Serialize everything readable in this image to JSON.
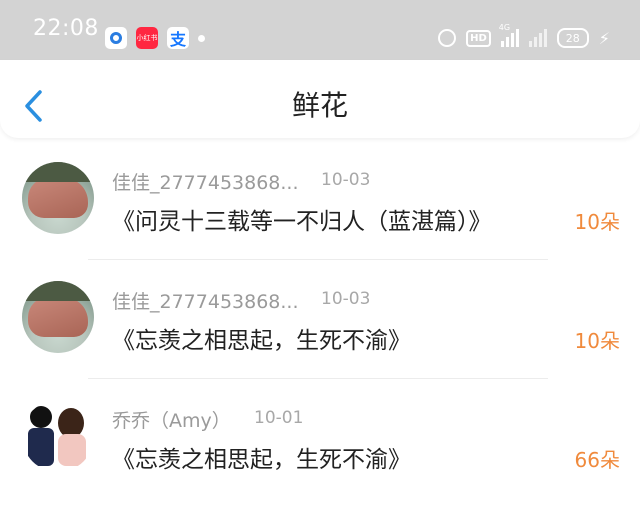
{
  "status_bar": {
    "time": "22:08",
    "apps": [
      "qq-browser-icon",
      "xiaohongshu-icon",
      "alipay-icon"
    ],
    "app_labels": {
      "xiaohongshu": "小红书",
      "alipay": "支"
    },
    "network": "4G",
    "hd": "HD",
    "battery": "28"
  },
  "header": {
    "title": "鲜花"
  },
  "records": [
    {
      "user": "佳佳_2777453868...",
      "date": "10-03",
      "book": "《问灵十三载等一不归人（蓝湛篇）》",
      "flowers": "10朵",
      "avatar": "stone"
    },
    {
      "user": "佳佳_2777453868...",
      "date": "10-03",
      "book": "《忘羡之相思起，生死不渝》",
      "flowers": "10朵",
      "avatar": "stone"
    },
    {
      "user": "乔乔（Amy）",
      "date": "10-01",
      "book": "《忘羡之相思起，生死不渝》",
      "flowers": "66朵",
      "avatar": "couple"
    }
  ],
  "colors": {
    "status_bar_bg": "#d3d3d3",
    "accent_back": "#2a8fe0",
    "flower_count": "#f08a3c"
  }
}
